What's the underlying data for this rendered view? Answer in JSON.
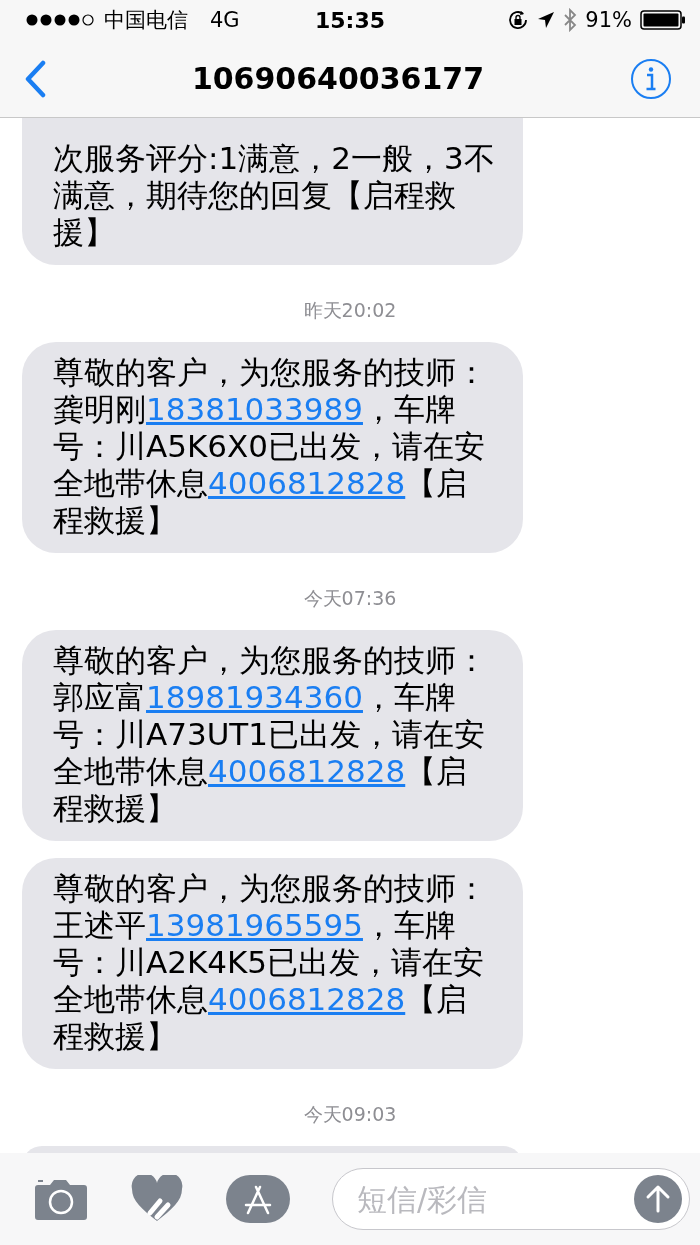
{
  "status_bar": {
    "carrier": "中国电信",
    "network": "4G",
    "time": "15:35",
    "battery": "91%"
  },
  "nav": {
    "title": "10690640036177"
  },
  "thread": [
    {
      "kind": "message",
      "cut_top": true,
      "segments": [
        {
          "kind": "text",
          "text": "次服务评分:1满意，2一般，3不满意，期待您的回复【启程救援】"
        }
      ]
    },
    {
      "kind": "time",
      "text": "昨天20:02"
    },
    {
      "kind": "message",
      "cut_top": false,
      "segments": [
        {
          "kind": "text",
          "text": "尊敬的客户，为您服务的技师：龚明刚"
        },
        {
          "kind": "link",
          "text": "18381033989"
        },
        {
          "kind": "text",
          "text": "，车牌号：川A5K6X0已出发，请在安全地带休息"
        },
        {
          "kind": "link",
          "text": "4006812828"
        },
        {
          "kind": "text",
          "text": "【启程救援】"
        }
      ]
    },
    {
      "kind": "time",
      "text": "今天07:36"
    },
    {
      "kind": "message",
      "cut_top": false,
      "segments": [
        {
          "kind": "text",
          "text": "尊敬的客户，为您服务的技师：郭应富"
        },
        {
          "kind": "link",
          "text": "18981934360"
        },
        {
          "kind": "text",
          "text": "，车牌号：川A73UT1已出发，请在安全地带休息"
        },
        {
          "kind": "link",
          "text": "4006812828"
        },
        {
          "kind": "text",
          "text": "【启程救援】"
        }
      ]
    },
    {
      "kind": "message",
      "cut_top": false,
      "segments": [
        {
          "kind": "text",
          "text": "尊敬的客户，为您服务的技师：王述平"
        },
        {
          "kind": "link",
          "text": "13981965595"
        },
        {
          "kind": "text",
          "text": "，车牌号：川A2K4K5已出发，请在安全地带休息"
        },
        {
          "kind": "link",
          "text": "4006812828"
        },
        {
          "kind": "text",
          "text": "【启程救援】"
        }
      ]
    },
    {
      "kind": "time",
      "text": "今天09:03"
    }
  ],
  "composer": {
    "placeholder": "短信/彩信"
  }
}
